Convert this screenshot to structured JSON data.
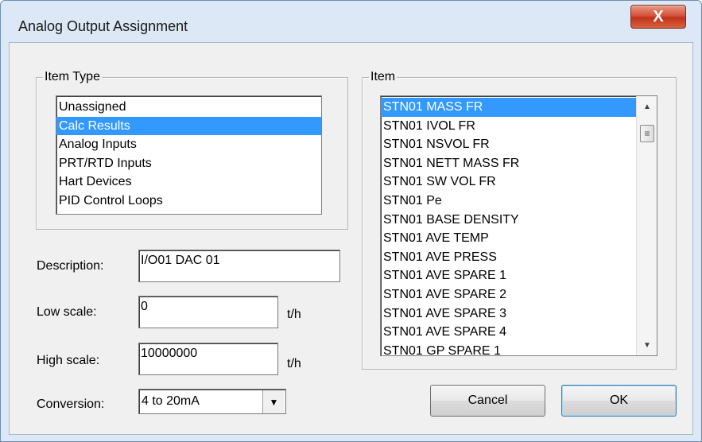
{
  "window": {
    "title": "Analog Output Assignment",
    "close_glyph": "X"
  },
  "item_type": {
    "label": "Item Type",
    "items": [
      "Unassigned",
      "Calc Results",
      "Analog Inputs",
      "PRT/RTD Inputs",
      "Hart Devices",
      "PID Control Loops"
    ],
    "selected": "Calc Results"
  },
  "item": {
    "label": "Item",
    "items": [
      "STN01 MASS FR",
      "STN01 IVOL FR",
      "STN01 NSVOL FR",
      "STN01 NETT MASS FR",
      "STN01 SW VOL FR",
      "STN01 Pe",
      "STN01 BASE DENSITY",
      "STN01 AVE TEMP",
      "STN01 AVE PRESS",
      "STN01 AVE SPARE 1",
      "STN01 AVE SPARE 2",
      "STN01 AVE SPARE 3",
      "STN01 AVE SPARE 4",
      "STN01 GP SPARE 1"
    ],
    "selected": "STN01 MASS FR"
  },
  "form": {
    "description_label": "Description:",
    "description_value": "I/O01 DAC 01",
    "low_scale_label": "Low scale:",
    "low_scale_value": "0",
    "low_scale_unit": "t/h",
    "high_scale_label": "High scale:",
    "high_scale_value": "10000000",
    "high_scale_unit": "t/h",
    "conversion_label": "Conversion:",
    "conversion_value": "4 to 20mA"
  },
  "buttons": {
    "cancel": "Cancel",
    "ok": "OK"
  },
  "icons": {
    "close": "close-icon",
    "dropdown": "chevron-down-icon",
    "scroll_up": "arrow-up-icon",
    "scroll_down": "arrow-down-icon",
    "scroll_thumb": "grip-icon"
  },
  "colors": {
    "selection": "#3399ff",
    "close_button": "#c0321c",
    "frame": "#dce8f5"
  }
}
